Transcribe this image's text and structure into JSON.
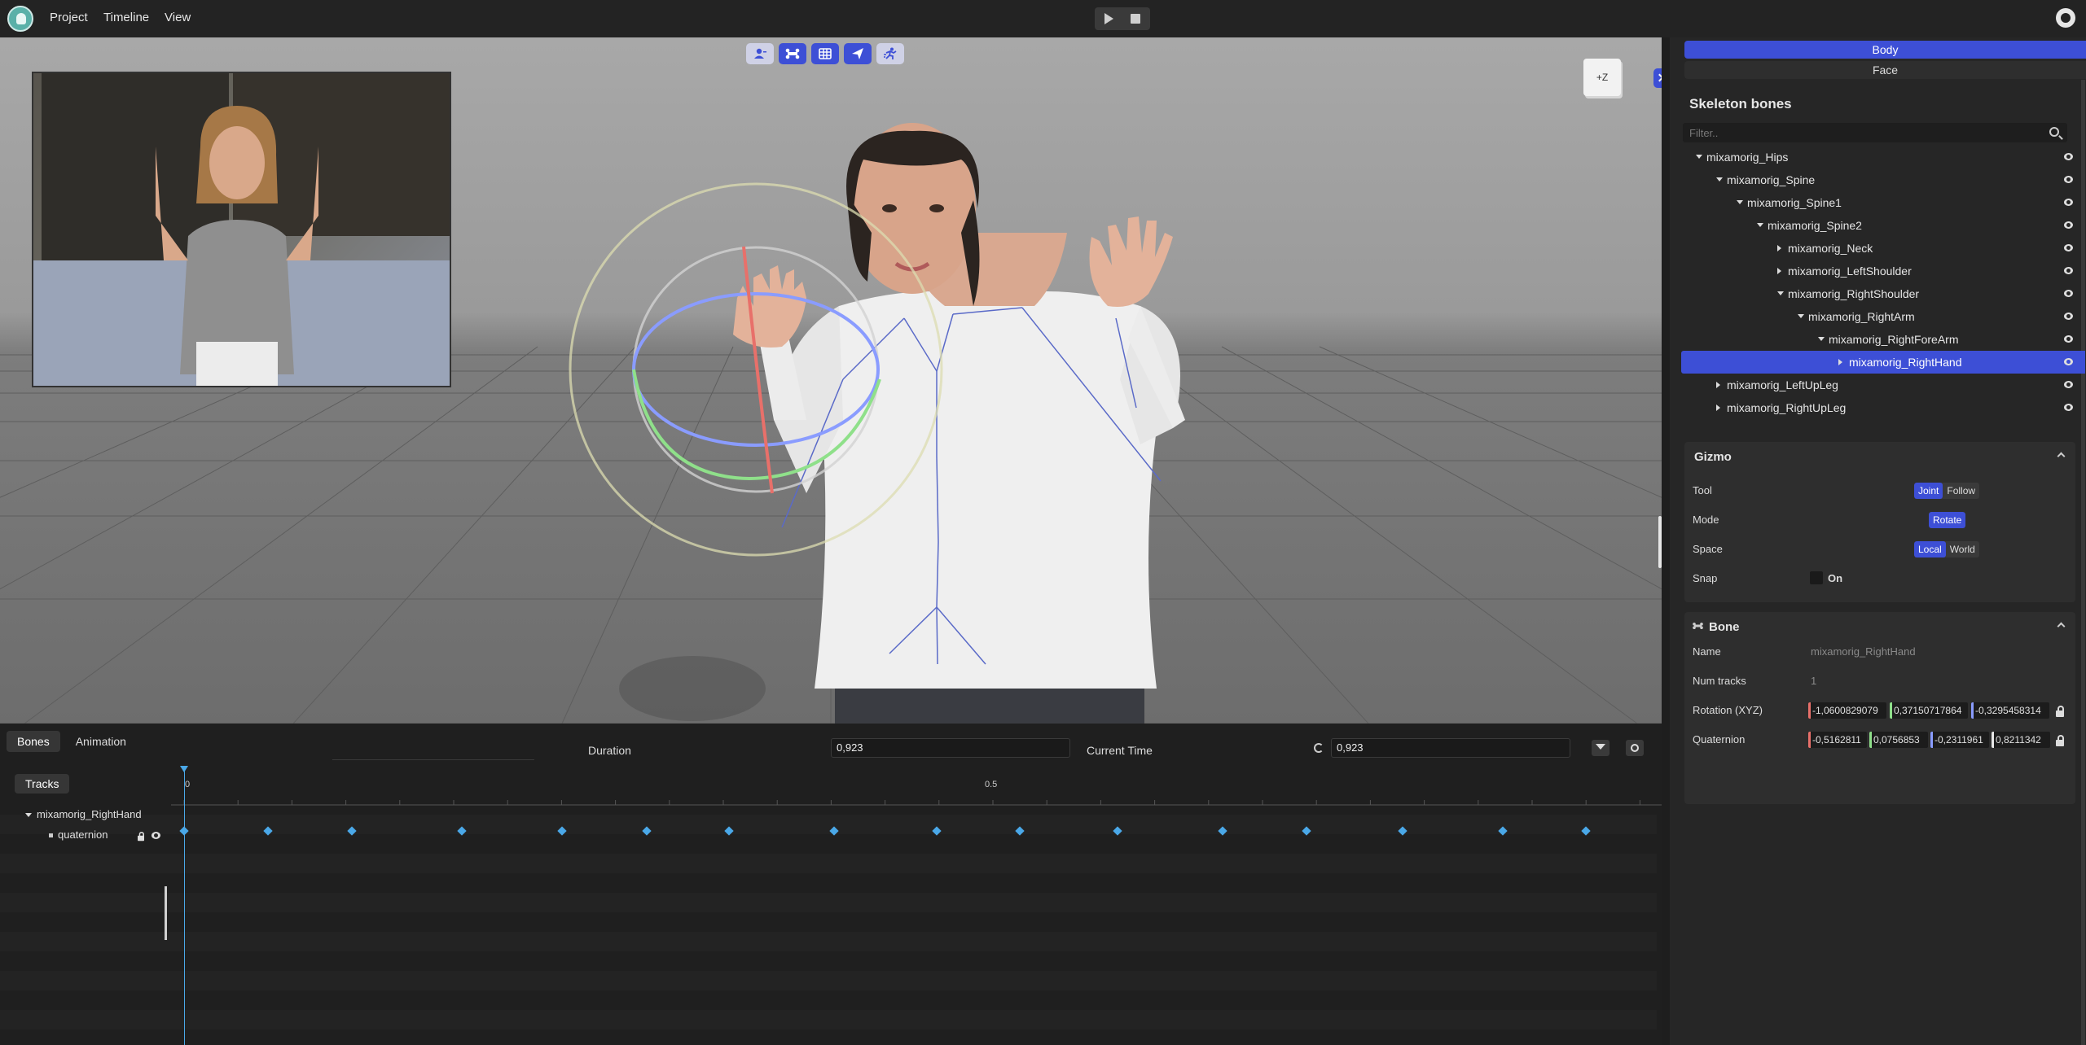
{
  "menu": {
    "items": [
      "Project",
      "Timeline",
      "View"
    ]
  },
  "viewport": {
    "axis_cube_label": "+Z",
    "toolbar_icons": [
      "user-icon",
      "bone-icon",
      "grid-icon",
      "send-icon",
      "pose-icon"
    ]
  },
  "right_panel": {
    "tabs": [
      "Body",
      "Face"
    ],
    "active_tab": "Body",
    "skeleton_title": "Skeleton bones",
    "filter_placeholder": "Filter..",
    "bones": [
      {
        "label": "mixamorig_Hips",
        "depth": 0,
        "caret": "open",
        "selected": false
      },
      {
        "label": "mixamorig_Spine",
        "depth": 1,
        "caret": "open",
        "selected": false
      },
      {
        "label": "mixamorig_Spine1",
        "depth": 2,
        "caret": "open",
        "selected": false
      },
      {
        "label": "mixamorig_Spine2",
        "depth": 3,
        "caret": "open",
        "selected": false
      },
      {
        "label": "mixamorig_Neck",
        "depth": 4,
        "caret": "closed",
        "selected": false
      },
      {
        "label": "mixamorig_LeftShoulder",
        "depth": 4,
        "caret": "closed",
        "selected": false
      },
      {
        "label": "mixamorig_RightShoulder",
        "depth": 4,
        "caret": "open",
        "selected": false
      },
      {
        "label": "mixamorig_RightArm",
        "depth": 5,
        "caret": "open",
        "selected": false
      },
      {
        "label": "mixamorig_RightForeArm",
        "depth": 6,
        "caret": "open",
        "selected": false
      },
      {
        "label": "mixamorig_RightHand",
        "depth": 7,
        "caret": "closed",
        "selected": true
      },
      {
        "label": "mixamorig_LeftUpLeg",
        "depth": 1,
        "caret": "closed",
        "selected": false
      },
      {
        "label": "mixamorig_RightUpLeg",
        "depth": 1,
        "caret": "closed",
        "selected": false
      }
    ],
    "gizmo": {
      "title": "Gizmo",
      "tool_label": "Tool",
      "tool_options": [
        "Joint",
        "Follow"
      ],
      "tool_selected": "Joint",
      "mode_label": "Mode",
      "mode_options": [
        "Rotate"
      ],
      "mode_selected": "Rotate",
      "space_label": "Space",
      "space_options": [
        "Local",
        "World"
      ],
      "space_selected": "Local",
      "snap_label": "Snap",
      "snap_value_label": "On"
    },
    "bone": {
      "title": "Bone",
      "name_label": "Name",
      "name_value": "mixamorig_RightHand",
      "num_tracks_label": "Num tracks",
      "num_tracks_value": "1",
      "rotation_label": "Rotation (XYZ)",
      "rotation_values": [
        "-1,0600829079",
        "0,37150717864",
        "-0,3295458314"
      ],
      "quaternion_label": "Quaternion",
      "quaternion_values": [
        "-0,5162811",
        "0,0756853",
        "-0,2311961",
        "0,8211342"
      ]
    }
  },
  "timeline": {
    "tabs": [
      "Bones",
      "Animation"
    ],
    "active_tab": "Bones",
    "duration_label": "Duration",
    "duration_value": "0,923",
    "current_time_label": "Current Time",
    "current_time_value": "0,923",
    "tracks_label": "Tracks",
    "ruler_labels": [
      "0",
      "0.5"
    ],
    "track_group": "mixamorig_RightHand",
    "track_name": "quaternion",
    "keyframe_count": 17
  },
  "colors": {
    "accent": "#3d4fd6",
    "axis_x": "#e8706a",
    "axis_y": "#8fe08a",
    "axis_z": "#8a9cff",
    "keyframe": "#4aa8e8"
  }
}
